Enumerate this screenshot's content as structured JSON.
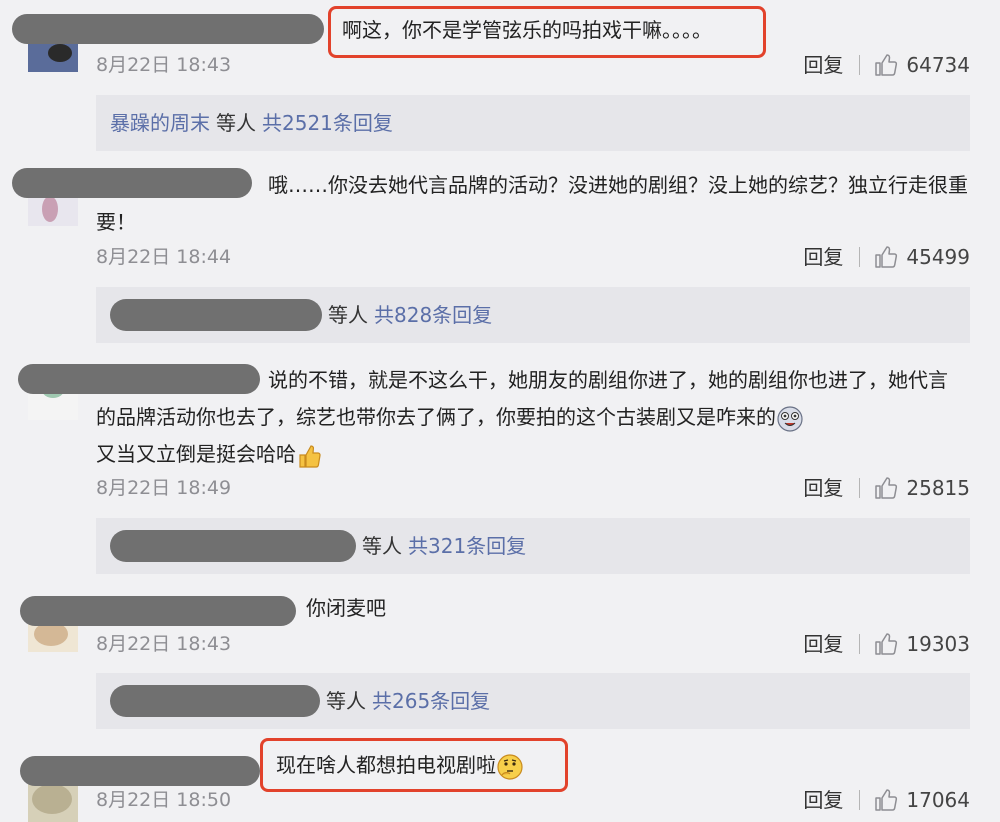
{
  "comments": [
    {
      "text": "啊这，你不是学管弦乐的吗拍戏干嘛。。。。",
      "time": "8月22日 18:43",
      "reply_label": "回复",
      "likes": "64734",
      "replies": {
        "user": "暴躁的周末",
        "others": "等人",
        "total": "共2521条回复"
      }
    },
    {
      "text": "哦……你没去她代言品牌的活动？没进她的剧组？没上她的综艺？独立行走很重要！",
      "time": "8月22日 18:44",
      "reply_label": "回复",
      "likes": "45499",
      "replies": {
        "others": "等人",
        "total": "共828条回复"
      }
    },
    {
      "text": "说的不错，就是不这么干，她朋友的剧组你进了，她的剧组你也进了，她代言的品牌活动你也去了，综艺也带你去了俩了，你要拍的这个古装剧又是咋来的",
      "text_tail": "又当又立倒是挺会哈哈",
      "emoji_a": "crazy-face",
      "emoji_b": "thumbs-up",
      "time": "8月22日 18:49",
      "reply_label": "回复",
      "likes": "25815",
      "replies": {
        "others": "等人",
        "total": "共321条回复"
      }
    },
    {
      "text": "你闭麦吧",
      "time": "8月22日 18:43",
      "reply_label": "回复",
      "likes": "19303",
      "replies": {
        "others": "等人",
        "total": "共265条回复"
      }
    },
    {
      "text": "现在啥人都想拍电视剧啦",
      "emoji": "thinking-face",
      "time": "8月22日 18:50",
      "reply_label": "回复",
      "likes": "17064"
    }
  ],
  "colors": {
    "link": "#5b6fa8",
    "highlight": "#e2422b",
    "background": "#f1f1f3"
  }
}
